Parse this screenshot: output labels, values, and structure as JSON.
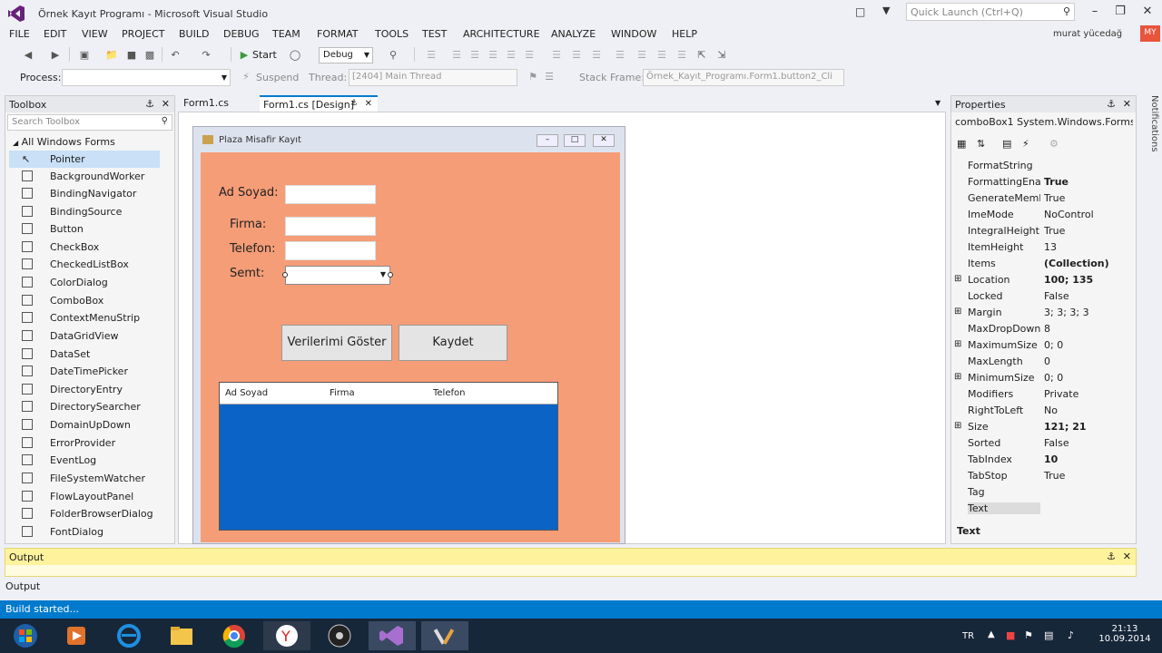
{
  "window": {
    "title": "Örnek Kayıt Programı - Microsoft Visual Studio",
    "quick_launch_placeholder": "Quick Launch (Ctrl+Q)",
    "user": "murat yücedağ",
    "avatar_initials": "MY"
  },
  "menu": [
    "FILE",
    "EDIT",
    "VIEW",
    "PROJECT",
    "BUILD",
    "DEBUG",
    "TEAM",
    "FORMAT",
    "TOOLS",
    "TEST",
    "ARCHITECTURE",
    "ANALYZE",
    "WINDOW",
    "HELP"
  ],
  "toolbar": {
    "start_label": "Start",
    "config_value": "Debug",
    "process_label": "Process:",
    "suspend_label": "Suspend",
    "thread_label": "Thread:",
    "thread_value": "[2404] Main Thread",
    "stack_frame_label": "Stack Frame:",
    "stack_frame_value": "Örnek_Kayıt_Programı.Form1.button2_Cli"
  },
  "toolbox": {
    "title": "Toolbox",
    "search_placeholder": "Search Toolbox",
    "group": "All Windows Forms",
    "items": [
      "Pointer",
      "BackgroundWorker",
      "BindingNavigator",
      "BindingSource",
      "Button",
      "CheckBox",
      "CheckedListBox",
      "ColorDialog",
      "ComboBox",
      "ContextMenuStrip",
      "DataGridView",
      "DataSet",
      "DateTimePicker",
      "DirectoryEntry",
      "DirectorySearcher",
      "DomainUpDown",
      "ErrorProvider",
      "EventLog",
      "FileSystemWatcher",
      "FlowLayoutPanel",
      "FolderBrowserDialog",
      "FontDialog"
    ]
  },
  "tabs": [
    "Form1.cs",
    "Form1.cs [Design]"
  ],
  "form": {
    "title": "Plaza Misafir Kayıt",
    "labels": {
      "ad_soyad": "Ad Soyad:",
      "firma": "Firma:",
      "telefon": "Telefon:",
      "semt": "Semt:"
    },
    "buttons": {
      "show": "Verilerimi Göster",
      "save": "Kaydet"
    },
    "list_columns": [
      "Ad Soyad",
      "Firma",
      "Telefon"
    ],
    "colors": {
      "client_bg": "#f59d77",
      "list_bg": "#0b63c6"
    }
  },
  "properties": {
    "title": "Properties",
    "object": "comboBox1 System.Windows.Forms",
    "rows": [
      {
        "name": "FormatString",
        "value": ""
      },
      {
        "name": "FormattingEnab",
        "value": "True"
      },
      {
        "name": "GenerateMembe",
        "value": "True"
      },
      {
        "name": "ImeMode",
        "value": "NoControl"
      },
      {
        "name": "IntegralHeight",
        "value": "True"
      },
      {
        "name": "ItemHeight",
        "value": "13"
      },
      {
        "name": "Items",
        "value": "(Collection)"
      },
      {
        "name": "Location",
        "value": "100; 135"
      },
      {
        "name": "Locked",
        "value": "False"
      },
      {
        "name": "Margin",
        "value": "3; 3; 3; 3"
      },
      {
        "name": "MaxDropDownIt",
        "value": "8"
      },
      {
        "name": "MaximumSize",
        "value": "0; 0"
      },
      {
        "name": "MaxLength",
        "value": "0"
      },
      {
        "name": "MinimumSize",
        "value": "0; 0"
      },
      {
        "name": "Modifiers",
        "value": "Private"
      },
      {
        "name": "RightToLeft",
        "value": "No"
      },
      {
        "name": "Size",
        "value": "121; 21"
      },
      {
        "name": "Sorted",
        "value": "False"
      },
      {
        "name": "TabIndex",
        "value": "10"
      },
      {
        "name": "TabStop",
        "value": "True"
      },
      {
        "name": "Tag",
        "value": ""
      },
      {
        "name": "Text",
        "value": ""
      }
    ],
    "description_title": "Text"
  },
  "side_notifications": "Notifications",
  "output": {
    "title": "Output",
    "tab": "Output",
    "status": "Build started..."
  },
  "tray": {
    "lang": "TR",
    "time": "21:13",
    "date": "10.09.2014"
  }
}
